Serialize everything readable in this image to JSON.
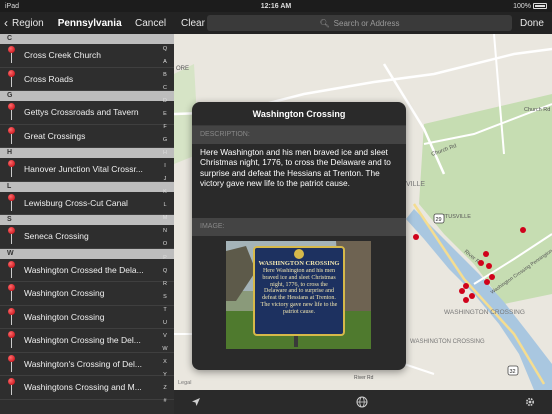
{
  "status": {
    "left": "iPad",
    "time": "12:16 AM",
    "battery": "100%"
  },
  "nav": {
    "back_label": "Region",
    "title": "Pennsylvania",
    "cancel_label": "Cancel",
    "clear_label": "Clear",
    "search_placeholder": "Search or Address",
    "done_label": "Done"
  },
  "sections": [
    {
      "letter": "C",
      "items": [
        "Cross Creek Church",
        "Cross Roads"
      ]
    },
    {
      "letter": "G",
      "items": [
        "Gettys Crossroads and Tavern",
        "Great Crossings"
      ]
    },
    {
      "letter": "H",
      "items": [
        "Hanover Junction Vital Crossr..."
      ]
    },
    {
      "letter": "L",
      "items": [
        "Lewisburg Cross-Cut Canal"
      ]
    },
    {
      "letter": "S",
      "items": [
        "Seneca Crossing"
      ]
    },
    {
      "letter": "W",
      "items": [
        "Washington Crossed the Dela...",
        "Washington Crossing",
        "Washington Crossing",
        "Washington Crossing the Del...",
        "Washington's Crossing of Del...",
        "Washingtons Crossing and M..."
      ]
    }
  ],
  "index_letters": [
    "Q",
    "A",
    "B",
    "C",
    "D",
    "E",
    "F",
    "G",
    "H",
    "I",
    "J",
    "K",
    "L",
    "M",
    "N",
    "O",
    "P",
    "Q",
    "R",
    "S",
    "T",
    "U",
    "V",
    "W",
    "X",
    "Y",
    "Z",
    "#"
  ],
  "popup": {
    "title": "Washington Crossing",
    "description_label": "DESCRIPTION:",
    "description": "Here Washington and his men braved ice and sleet Christmas night, 1776, to cross the Delaware and to surprise and defeat the Hessians at Trenton. The victory gave new life to the patriot cause.",
    "image_label": "IMAGE:",
    "plaque_title": "WASHINGTON CROSSING",
    "plaque_text": "Here Washington and his men braved ice and sleet Christmas night, 1776, to cross the Delaware and to surprise and defeat the Hessians at Trenton. The victory gave new life to the patriot cause."
  },
  "map": {
    "labels": {
      "ore": "ORE",
      "church_rd": "Church Rd",
      "church_rd_2": "Church Rd",
      "ville": "VILLE",
      "titusville": "TITUSVILLE",
      "river_rd": "River Rd",
      "washington_crossing_pennington": "Washington Crossing Pennington Rd",
      "washington_crossing": "WASHINGTON CROSSING",
      "washington_crossing_2": "WASHINGTON CROSSING",
      "legal": "Legal",
      "route_29": "29",
      "route_32": "32",
      "river_road": "River Rd"
    },
    "colors": {
      "water": "#a9c7e0",
      "park": "#c6ddb2",
      "road": "#ffffff",
      "pin": "#d0021b"
    }
  }
}
